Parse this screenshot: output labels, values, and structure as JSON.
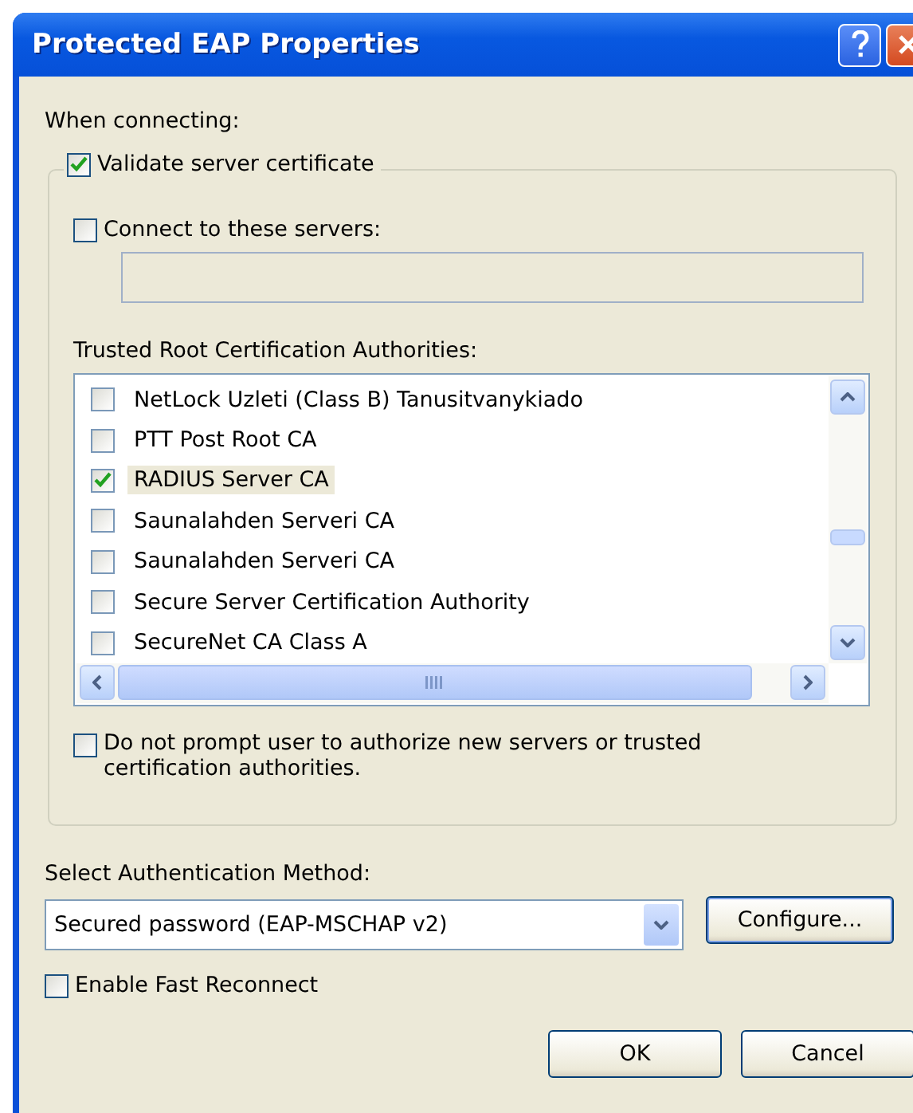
{
  "window": {
    "title": "Protected EAP Properties"
  },
  "when_connecting": {
    "label": "When connecting:"
  },
  "validate": {
    "label": "Validate server certificate",
    "checked": true
  },
  "connect_servers": {
    "label": "Connect to these servers:",
    "checked": false
  },
  "trusted_label": "Trusted Root Certification Authorities:",
  "authorities": [
    {
      "label": "NetLock Uzleti (Class B) Tanusitvanykiado",
      "checked": false,
      "selected": false
    },
    {
      "label": "PTT Post Root CA",
      "checked": false,
      "selected": false
    },
    {
      "label": "RADIUS Server CA",
      "checked": true,
      "selected": true
    },
    {
      "label": "Saunalahden Serveri CA",
      "checked": false,
      "selected": false
    },
    {
      "label": "Saunalahden Serveri CA",
      "checked": false,
      "selected": false
    },
    {
      "label": "Secure Server Certification Authority",
      "checked": false,
      "selected": false
    },
    {
      "label": "SecureNet CA Class A",
      "checked": false,
      "selected": false
    }
  ],
  "no_prompt": {
    "label": "Do not prompt user to authorize new servers or trusted certification authorities.",
    "checked": false
  },
  "auth_label": "Select Authentication Method:",
  "auth_method": {
    "value": "Secured password (EAP-MSCHAP v2)"
  },
  "configure_button": "Configure...",
  "fast_reconnect": {
    "label": "Enable Fast Reconnect",
    "checked": false
  },
  "buttons": [
    "OK",
    "Cancel"
  ]
}
